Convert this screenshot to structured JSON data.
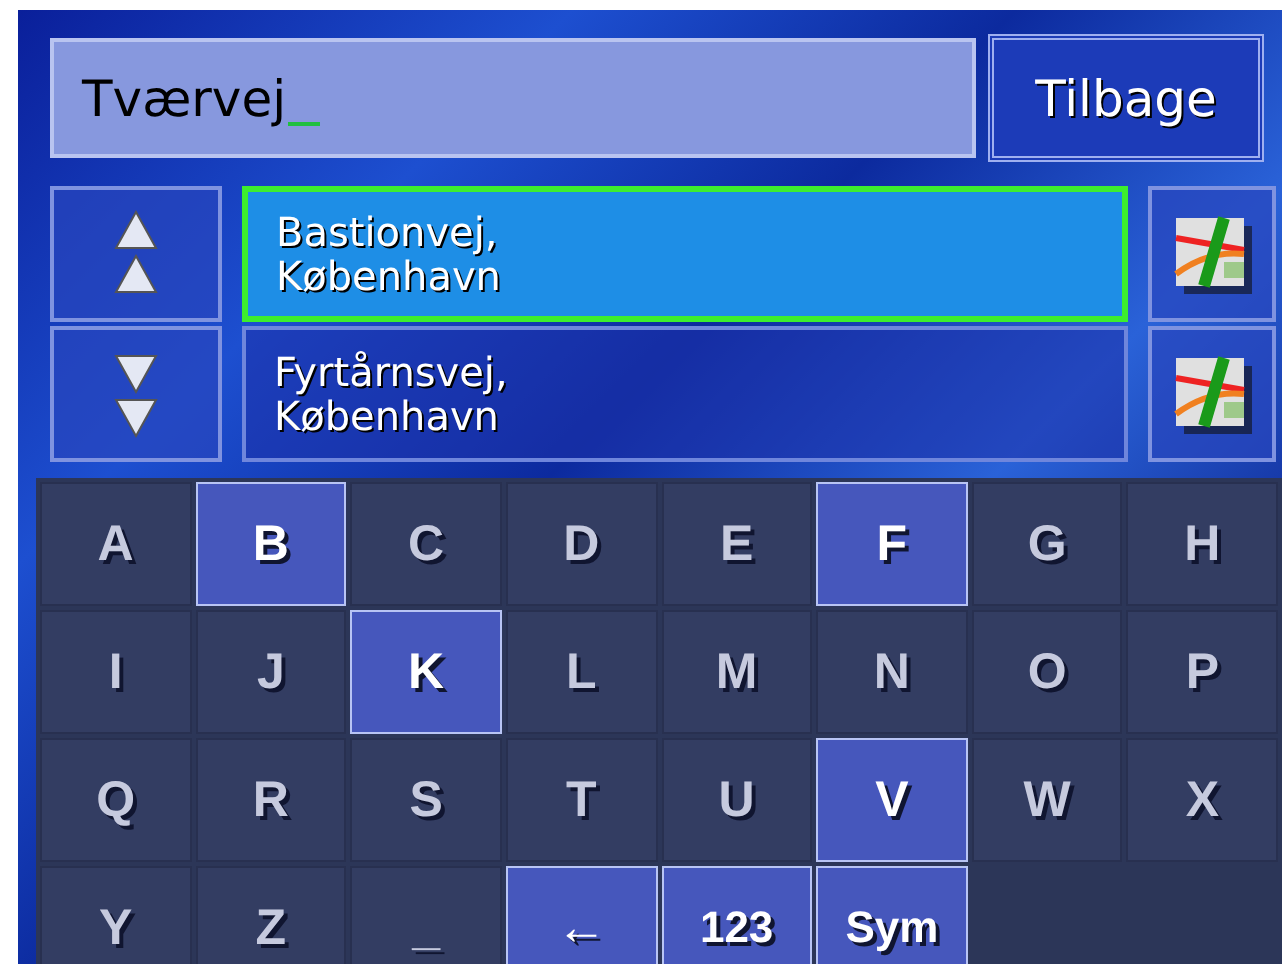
{
  "search": {
    "value": "Tværvej"
  },
  "back_button": "Tilbage",
  "results": [
    {
      "street": "Bastionvej,",
      "city": "København",
      "selected": true
    },
    {
      "street": "Fyrtårnsvej,",
      "city": "København",
      "selected": false
    }
  ],
  "keyboard": [
    {
      "label": "A",
      "highlighted": false
    },
    {
      "label": "B",
      "highlighted": true
    },
    {
      "label": "C",
      "highlighted": false
    },
    {
      "label": "D",
      "highlighted": false
    },
    {
      "label": "E",
      "highlighted": false
    },
    {
      "label": "F",
      "highlighted": true
    },
    {
      "label": "G",
      "highlighted": false
    },
    {
      "label": "H",
      "highlighted": false
    },
    {
      "label": "I",
      "highlighted": false
    },
    {
      "label": "J",
      "highlighted": false
    },
    {
      "label": "K",
      "highlighted": true
    },
    {
      "label": "L",
      "highlighted": false
    },
    {
      "label": "M",
      "highlighted": false
    },
    {
      "label": "N",
      "highlighted": false
    },
    {
      "label": "O",
      "highlighted": false
    },
    {
      "label": "P",
      "highlighted": false
    },
    {
      "label": "Q",
      "highlighted": false
    },
    {
      "label": "R",
      "highlighted": false
    },
    {
      "label": "S",
      "highlighted": false
    },
    {
      "label": "T",
      "highlighted": false
    },
    {
      "label": "U",
      "highlighted": false
    },
    {
      "label": "V",
      "highlighted": true
    },
    {
      "label": "W",
      "highlighted": false
    },
    {
      "label": "X",
      "highlighted": false
    },
    {
      "label": "Y",
      "highlighted": false
    },
    {
      "label": "Z",
      "highlighted": false
    },
    {
      "label": "_",
      "highlighted": false
    },
    {
      "label": "←",
      "highlighted": true
    },
    {
      "label": "123",
      "highlighted": true
    },
    {
      "label": "Sym",
      "highlighted": true
    }
  ]
}
